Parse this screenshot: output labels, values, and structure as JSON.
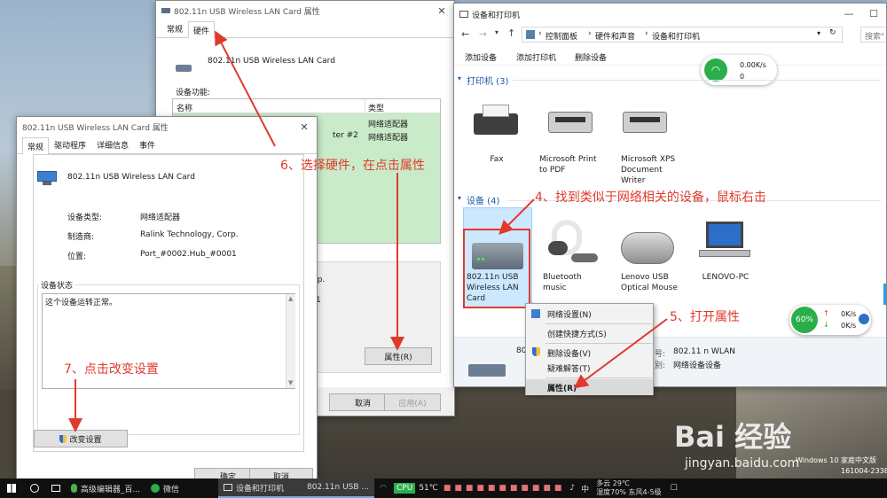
{
  "win_back": {
    "title": "802.11n USB Wireless LAN Card 属性",
    "tabs": [
      "常规",
      "硬件"
    ],
    "device_name": "802.11n USB Wireless LAN Card",
    "functions_label": "设备功能:",
    "col_name": "名称",
    "col_type": "类型",
    "rows": [
      {
        "name": "",
        "type": "网络适配器"
      },
      {
        "name": "ter #2",
        "type": "网络适配器"
      }
    ],
    "frag1": "rp.",
    "frag2": "1",
    "properties_btn": "属性(R)",
    "cancel_btn": "取消",
    "apply_btn": "应用(A)"
  },
  "win_front": {
    "title": "802.11n USB Wireless LAN Card 属性",
    "tabs": [
      "常规",
      "驱动程序",
      "详细信息",
      "事件"
    ],
    "device_name": "802.11n USB Wireless LAN Card",
    "type_label": "设备类型:",
    "type_value": "网络适配器",
    "mfr_label": "制造商:",
    "mfr_value": "Ralink Technology, Corp.",
    "loc_label": "位置:",
    "loc_value": "Port_#0002.Hub_#0001",
    "status_group": "设备状态",
    "status_text": "这个设备运转正常。",
    "change_btn": "改变设置",
    "ok_btn": "确定",
    "cancel_btn": "取消"
  },
  "win_dev": {
    "title": "设备和打印机",
    "breadcrumb": [
      "控制面板",
      "硬件和声音",
      "设备和打印机"
    ],
    "search_placeholder": "搜索\"",
    "toolbar": [
      "添加设备",
      "添加打印机",
      "删除设备"
    ],
    "printers_header": "打印机 (3)",
    "devices_header": "设备 (4)",
    "printers": [
      {
        "name": "Fax"
      },
      {
        "name": "Microsoft Print to PDF"
      },
      {
        "name": "Microsoft XPS Document Writer"
      }
    ],
    "devices": [
      {
        "name": "802.11n USB Wireless LAN Card"
      },
      {
        "name": "Bluetooth music"
      },
      {
        "name": "Lenovo USB Optical Mouse"
      },
      {
        "name": "LENOVO-PC"
      }
    ],
    "details_frag": "80",
    "details_model_label": "号:",
    "details_model_value": "802.11 n WLAN",
    "details_cat_label": "别:",
    "details_cat_value": "网络设备设备",
    "net_widget_speed1": "0.00K/s",
    "net_widget_speed2": "0"
  },
  "context_menu": {
    "items": [
      "网络设置(N)",
      "创建快捷方式(S)",
      "删除设备(V)",
      "疑难解答(T)",
      "属性(R)"
    ]
  },
  "annotations": {
    "step4": "4、找到类似于网络相关的设备，鼠标右击",
    "step5": "5、打开属性",
    "step6": "6、选择硬件，在点击属性",
    "step7": "7、点击改变设置"
  },
  "speed_widget": {
    "percent": "60%",
    "up": "0K/s",
    "down": "0K/s"
  },
  "watermark": {
    "brand": "Bai 经验",
    "url": "jingyan.baidu.com",
    "win_edition": "Windows 10 家庭中文版",
    "build": "161004-2338"
  },
  "taskbar": {
    "tasks": [
      "高级编辑器_百...",
      "微信",
      "设备和打印机",
      "802.11n USB ..."
    ],
    "cpu": "CPU",
    "temp": "51℃",
    "ime": "中",
    "weather": "多云 29℃",
    "weather2": "湿度70% 东风4-5级"
  },
  "colors": {
    "accent": "#e03a2d",
    "selection": "#cce8ff",
    "green_list": "#c9ebc9"
  }
}
